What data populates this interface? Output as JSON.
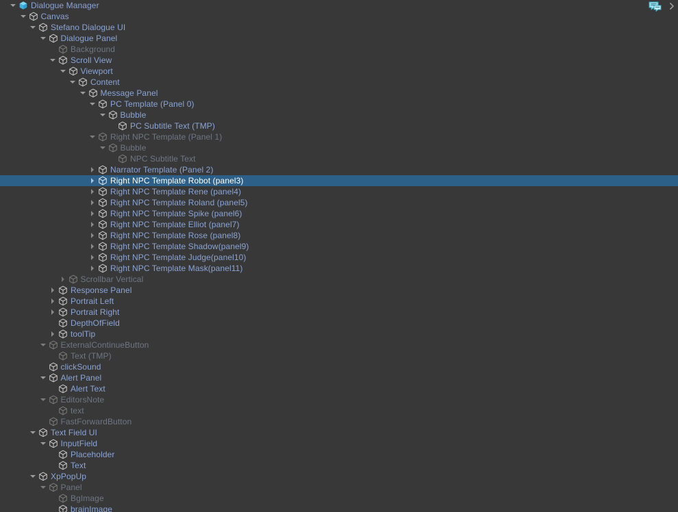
{
  "panel": {
    "name": "Hierarchy",
    "background_color": "#383838",
    "selection_color": "#2c6088",
    "text_color": "#8aa4d6",
    "inactive_text_color": "#6f7684",
    "selected_text_color": "#ffffff",
    "prefab_icon_color": "#4ec3ea"
  },
  "header": {
    "icons": [
      {
        "name": "dialogue-script-icon",
        "label": "Dialogue script"
      },
      {
        "name": "panel-menu-chevron",
        "label": ">"
      }
    ]
  },
  "tree": {
    "rows": [
      {
        "depth": 0,
        "label": "Dialogue Manager",
        "twisty": "expanded",
        "icon": "prefab-cube",
        "state": "active",
        "selected": false
      },
      {
        "depth": 1,
        "label": "Canvas",
        "twisty": "expanded",
        "icon": "gameobject-cube",
        "state": "active",
        "selected": false
      },
      {
        "depth": 2,
        "label": "Stefano Dialogue UI",
        "twisty": "expanded",
        "icon": "gameobject-cube",
        "state": "active",
        "selected": false
      },
      {
        "depth": 3,
        "label": "Dialogue Panel",
        "twisty": "expanded",
        "icon": "gameobject-cube",
        "state": "active",
        "selected": false
      },
      {
        "depth": 4,
        "label": "Background",
        "twisty": "none",
        "icon": "gameobject-cube",
        "state": "inactive",
        "selected": false
      },
      {
        "depth": 4,
        "label": "Scroll View",
        "twisty": "expanded",
        "icon": "gameobject-cube",
        "state": "active",
        "selected": false
      },
      {
        "depth": 5,
        "label": "Viewport",
        "twisty": "expanded",
        "icon": "gameobject-cube",
        "state": "active",
        "selected": false
      },
      {
        "depth": 6,
        "label": "Content",
        "twisty": "expanded",
        "icon": "gameobject-cube",
        "state": "active",
        "selected": false
      },
      {
        "depth": 7,
        "label": "Message Panel",
        "twisty": "expanded",
        "icon": "gameobject-cube",
        "state": "active",
        "selected": false
      },
      {
        "depth": 8,
        "label": "PC Template (Panel 0)",
        "twisty": "expanded",
        "icon": "gameobject-cube",
        "state": "active",
        "selected": false
      },
      {
        "depth": 9,
        "label": "Bubble",
        "twisty": "expanded",
        "icon": "gameobject-cube",
        "state": "active",
        "selected": false
      },
      {
        "depth": 10,
        "label": "PC Subtitle Text (TMP)",
        "twisty": "none",
        "icon": "gameobject-cube",
        "state": "active",
        "selected": false
      },
      {
        "depth": 8,
        "label": "Right NPC Template (Panel 1)",
        "twisty": "expanded",
        "icon": "gameobject-cube",
        "state": "inactive",
        "selected": false
      },
      {
        "depth": 9,
        "label": "Bubble",
        "twisty": "expanded",
        "icon": "gameobject-cube",
        "state": "inactive",
        "selected": false
      },
      {
        "depth": 10,
        "label": "NPC Subtitle Text",
        "twisty": "none",
        "icon": "gameobject-cube",
        "state": "inactive",
        "selected": false
      },
      {
        "depth": 8,
        "label": "Narrator Template (Panel 2)",
        "twisty": "collapsed",
        "icon": "gameobject-cube",
        "state": "active",
        "selected": false
      },
      {
        "depth": 8,
        "label": "Right NPC Template Robot (panel3)",
        "twisty": "collapsed",
        "icon": "gameobject-cube",
        "state": "active",
        "selected": true
      },
      {
        "depth": 8,
        "label": "Right NPC Template Rene (panel4)",
        "twisty": "collapsed",
        "icon": "gameobject-cube",
        "state": "active",
        "selected": false
      },
      {
        "depth": 8,
        "label": "Right NPC Template Roland (panel5)",
        "twisty": "collapsed",
        "icon": "gameobject-cube",
        "state": "active",
        "selected": false
      },
      {
        "depth": 8,
        "label": "Right NPC Template Spike (panel6)",
        "twisty": "collapsed",
        "icon": "gameobject-cube",
        "state": "active",
        "selected": false
      },
      {
        "depth": 8,
        "label": "Right NPC Template Elliot (panel7)",
        "twisty": "collapsed",
        "icon": "gameobject-cube",
        "state": "active",
        "selected": false
      },
      {
        "depth": 8,
        "label": "Right NPC Template Rose (panel8)",
        "twisty": "collapsed",
        "icon": "gameobject-cube",
        "state": "active",
        "selected": false
      },
      {
        "depth": 8,
        "label": "Right NPC Template Shadow(panel9)",
        "twisty": "collapsed",
        "icon": "gameobject-cube",
        "state": "active",
        "selected": false
      },
      {
        "depth": 8,
        "label": "Right NPC Template Judge(panel10)",
        "twisty": "collapsed",
        "icon": "gameobject-cube",
        "state": "active",
        "selected": false
      },
      {
        "depth": 8,
        "label": "Right NPC Template Mask(panel11)",
        "twisty": "collapsed",
        "icon": "gameobject-cube",
        "state": "active",
        "selected": false
      },
      {
        "depth": 5,
        "label": "Scrollbar Vertical",
        "twisty": "collapsed",
        "icon": "gameobject-cube",
        "state": "inactive",
        "selected": false
      },
      {
        "depth": 4,
        "label": "Response Panel",
        "twisty": "collapsed",
        "icon": "gameobject-cube",
        "state": "active",
        "selected": false
      },
      {
        "depth": 4,
        "label": "Portrait Left",
        "twisty": "collapsed",
        "icon": "gameobject-cube",
        "state": "active",
        "selected": false
      },
      {
        "depth": 4,
        "label": "Portrait Right",
        "twisty": "collapsed",
        "icon": "gameobject-cube",
        "state": "active",
        "selected": false
      },
      {
        "depth": 4,
        "label": "DepthOfField",
        "twisty": "none",
        "icon": "gameobject-cube",
        "state": "active",
        "selected": false
      },
      {
        "depth": 4,
        "label": "toolTip",
        "twisty": "collapsed",
        "icon": "gameobject-cube",
        "state": "active",
        "selected": false
      },
      {
        "depth": 3,
        "label": "ExternalContinueButton",
        "twisty": "expanded",
        "icon": "gameobject-cube",
        "state": "inactive",
        "selected": false
      },
      {
        "depth": 4,
        "label": "Text (TMP)",
        "twisty": "none",
        "icon": "gameobject-cube",
        "state": "inactive",
        "selected": false
      },
      {
        "depth": 3,
        "label": "clickSound",
        "twisty": "none",
        "icon": "gameobject-cube",
        "state": "active",
        "selected": false
      },
      {
        "depth": 3,
        "label": "Alert Panel",
        "twisty": "expanded",
        "icon": "gameobject-cube",
        "state": "active",
        "selected": false
      },
      {
        "depth": 4,
        "label": "Alert Text",
        "twisty": "none",
        "icon": "gameobject-cube",
        "state": "active",
        "selected": false
      },
      {
        "depth": 3,
        "label": "EditorsNote",
        "twisty": "expanded",
        "icon": "gameobject-cube",
        "state": "inactive",
        "selected": false
      },
      {
        "depth": 4,
        "label": "text",
        "twisty": "none",
        "icon": "gameobject-cube",
        "state": "inactive",
        "selected": false
      },
      {
        "depth": 3,
        "label": "FastForwardButton",
        "twisty": "none",
        "icon": "gameobject-cube",
        "state": "inactive",
        "selected": false
      },
      {
        "depth": 2,
        "label": "Text Field UI",
        "twisty": "expanded",
        "icon": "gameobject-cube",
        "state": "active",
        "selected": false
      },
      {
        "depth": 3,
        "label": "InputField",
        "twisty": "expanded",
        "icon": "gameobject-cube",
        "state": "active",
        "selected": false
      },
      {
        "depth": 4,
        "label": "Placeholder",
        "twisty": "none",
        "icon": "gameobject-cube",
        "state": "active",
        "selected": false
      },
      {
        "depth": 4,
        "label": "Text",
        "twisty": "none",
        "icon": "gameobject-cube",
        "state": "active",
        "selected": false
      },
      {
        "depth": 2,
        "label": "XpPopUp",
        "twisty": "expanded",
        "icon": "gameobject-cube",
        "state": "active",
        "selected": false
      },
      {
        "depth": 3,
        "label": "Panel",
        "twisty": "expanded",
        "icon": "gameobject-cube",
        "state": "inactive",
        "selected": false
      },
      {
        "depth": 4,
        "label": "BgImage",
        "twisty": "none",
        "icon": "gameobject-cube",
        "state": "inactive",
        "selected": false
      },
      {
        "depth": 4,
        "label": "brainImage",
        "twisty": "none",
        "icon": "gameobject-cube",
        "state": "active",
        "selected": false
      }
    ]
  }
}
